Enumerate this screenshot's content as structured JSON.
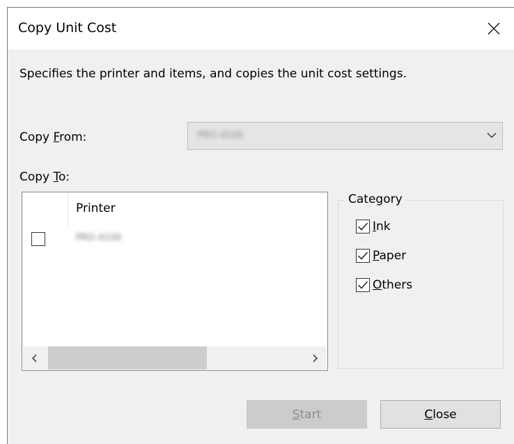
{
  "window": {
    "title": "Copy Unit Cost",
    "close_icon": "close-icon"
  },
  "description": "Specifies the printer and items, and copies the unit cost settings.",
  "copy_from": {
    "label": "Copy From:",
    "mnemonic": "F",
    "value": "PRO-4100",
    "icon": "chevron-down-icon"
  },
  "copy_to": {
    "label": "Copy To:",
    "mnemonic": "T",
    "columns": [
      "Printer"
    ],
    "rows": [
      {
        "checked": false,
        "printer": "PRO-4100"
      }
    ]
  },
  "category": {
    "title": "Category",
    "items": [
      {
        "label": "Ink",
        "mnemonic": "I",
        "checked": true
      },
      {
        "label": "Paper",
        "mnemonic": "P",
        "checked": true
      },
      {
        "label": "Others",
        "mnemonic": "O",
        "checked": true
      }
    ]
  },
  "buttons": {
    "start": {
      "label": "Start",
      "mnemonic": "S",
      "enabled": false
    },
    "close": {
      "label": "Close",
      "mnemonic": "C",
      "enabled": true
    }
  },
  "scrollbar": {
    "left_icon": "chevron-left-icon",
    "right_icon": "chevron-right-icon"
  }
}
